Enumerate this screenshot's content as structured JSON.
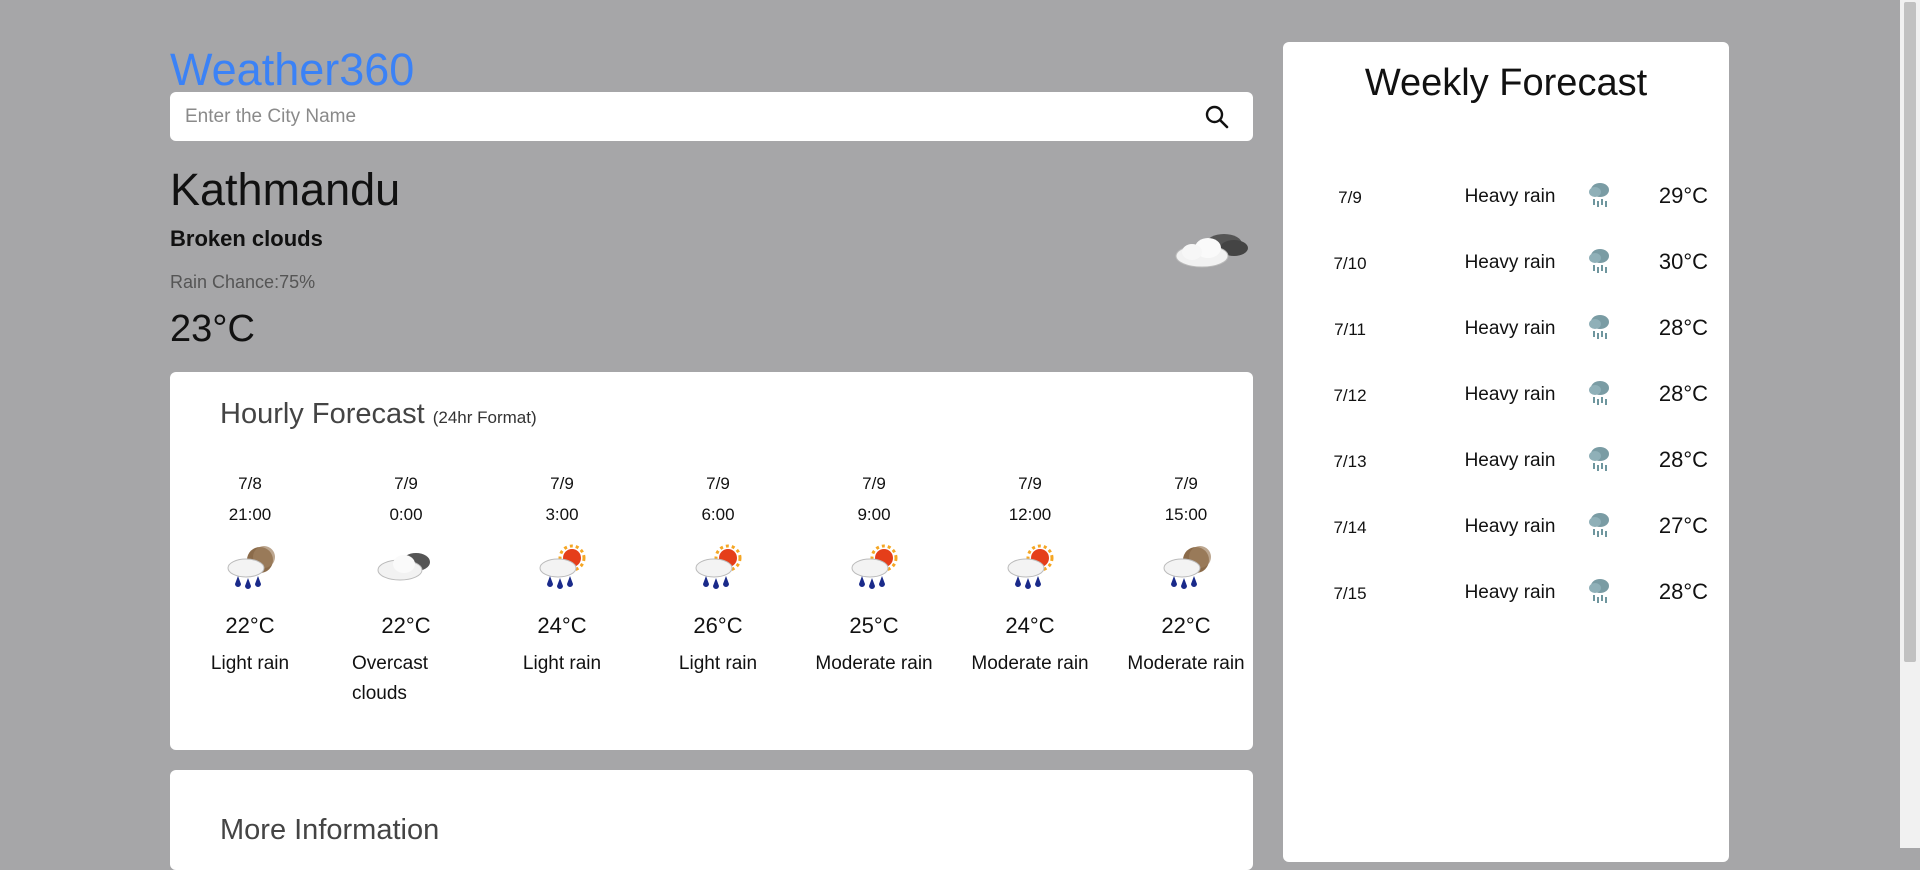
{
  "app": {
    "logo": "Weather360",
    "accent": "#3b82f6"
  },
  "search": {
    "placeholder": "Enter the City Name",
    "value": ""
  },
  "current": {
    "city": "Kathmandu",
    "condition": "Broken clouds",
    "rain_chance": "Rain Chance:75%",
    "temperature": "23°C",
    "icon": "broken-clouds-icon"
  },
  "hourly": {
    "title": "Hourly Forecast",
    "subtitle": "(24hr Format)",
    "items": [
      {
        "date": "7/8",
        "time": "21:00",
        "temp": "22°C",
        "desc": "Light rain",
        "icon": "rain-night-icon"
      },
      {
        "date": "7/9",
        "time": "0:00",
        "temp": "22°C",
        "desc": "Overcast clouds",
        "icon": "overcast-clouds-icon"
      },
      {
        "date": "7/9",
        "time": "3:00",
        "temp": "24°C",
        "desc": "Light rain",
        "icon": "rain-sun-icon"
      },
      {
        "date": "7/9",
        "time": "6:00",
        "temp": "26°C",
        "desc": "Light rain",
        "icon": "rain-sun-icon"
      },
      {
        "date": "7/9",
        "time": "9:00",
        "temp": "25°C",
        "desc": "Moderate rain",
        "icon": "rain-sun-icon"
      },
      {
        "date": "7/9",
        "time": "12:00",
        "temp": "24°C",
        "desc": "Moderate rain",
        "icon": "rain-sun-icon"
      },
      {
        "date": "7/9",
        "time": "15:00",
        "temp": "22°C",
        "desc": "Moderate rain",
        "icon": "rain-night-icon"
      }
    ]
  },
  "more": {
    "title": "More Information"
  },
  "weekly": {
    "title": "Weekly Forecast",
    "items": [
      {
        "date": "7/9",
        "desc": "Heavy rain",
        "temp": "29°C",
        "icon": "heavy-rain-icon"
      },
      {
        "date": "7/10",
        "desc": "Heavy rain",
        "temp": "30°C",
        "icon": "heavy-rain-icon"
      },
      {
        "date": "7/11",
        "desc": "Heavy rain",
        "temp": "28°C",
        "icon": "heavy-rain-icon"
      },
      {
        "date": "7/12",
        "desc": "Heavy rain",
        "temp": "28°C",
        "icon": "heavy-rain-icon"
      },
      {
        "date": "7/13",
        "desc": "Heavy rain",
        "temp": "28°C",
        "icon": "heavy-rain-icon"
      },
      {
        "date": "7/14",
        "desc": "Heavy rain",
        "temp": "27°C",
        "icon": "heavy-rain-icon"
      },
      {
        "date": "7/15",
        "desc": "Heavy rain",
        "temp": "28°C",
        "icon": "heavy-rain-icon"
      }
    ]
  }
}
